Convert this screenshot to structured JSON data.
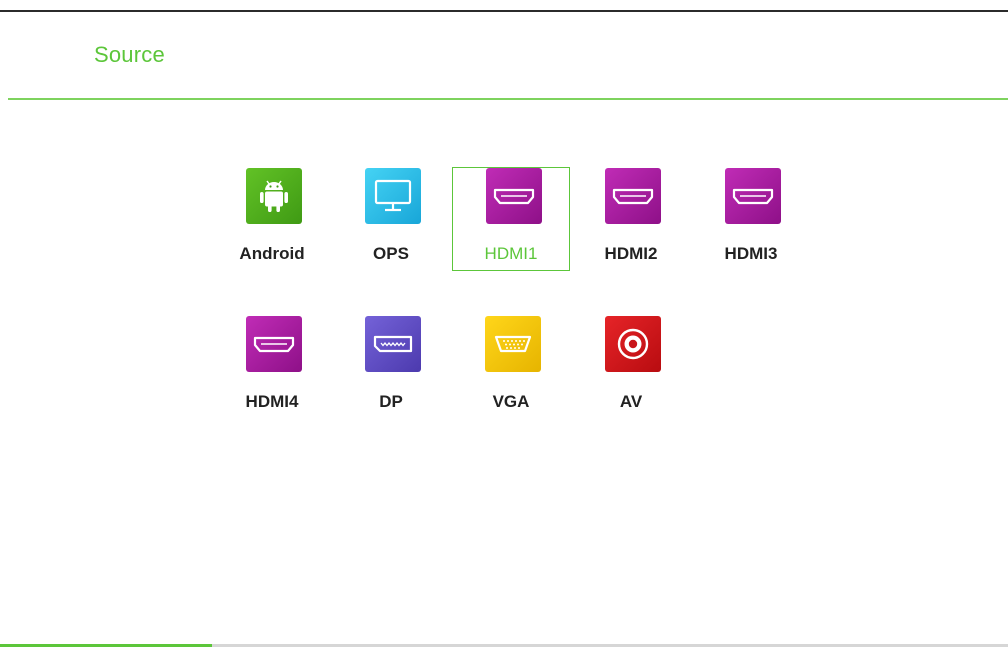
{
  "header": {
    "title": "Source"
  },
  "colors": {
    "accent": "#5cc63a",
    "android": "#4caf1a",
    "ops": "#29c3ea",
    "hdmi": "#b21aa6",
    "dp": "#6350c8",
    "vga": "#f2c400",
    "av": "#d8181c"
  },
  "sources": [
    {
      "label": "Android",
      "icon": "android-icon",
      "selected": false
    },
    {
      "label": "OPS",
      "icon": "monitor-icon",
      "selected": false
    },
    {
      "label": "HDMI1",
      "icon": "hdmi-port-icon",
      "selected": true
    },
    {
      "label": "HDMI2",
      "icon": "hdmi-port-icon",
      "selected": false
    },
    {
      "label": "HDMI3",
      "icon": "hdmi-port-icon",
      "selected": false
    },
    {
      "label": "HDMI4",
      "icon": "hdmi-port-icon",
      "selected": false
    },
    {
      "label": "DP",
      "icon": "displayport-icon",
      "selected": false
    },
    {
      "label": "VGA",
      "icon": "vga-port-icon",
      "selected": false
    },
    {
      "label": "AV",
      "icon": "rca-port-icon",
      "selected": false
    }
  ],
  "progress": {
    "fraction": 0.21
  }
}
